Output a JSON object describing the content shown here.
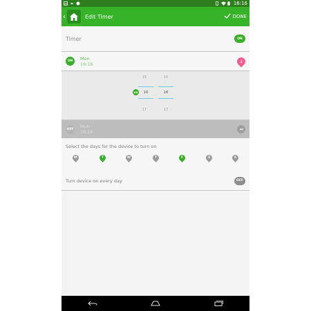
{
  "status_bar": {
    "time": "16:16"
  },
  "app_bar": {
    "back": "‹",
    "title": "Edit Timer",
    "done_label": "DONE"
  },
  "timer_row": {
    "label": "Timer",
    "toggle": "ON"
  },
  "on_event": {
    "badge": "ON",
    "day": "Mon",
    "time": "16:16"
  },
  "picker": {
    "hour_above": "15",
    "hour": "16",
    "hour_below": "17",
    "minute_above": "15",
    "minute": "16",
    "minute_below": "17",
    "badge": "ON"
  },
  "off_event": {
    "badge": "OFF",
    "day": "Mon",
    "time": "16:16"
  },
  "days_section": {
    "title": "Select the days for the device to turn on",
    "days": [
      {
        "label": "M",
        "selected": false
      },
      {
        "label": "T",
        "selected": true
      },
      {
        "label": "W",
        "selected": false
      },
      {
        "label": "T",
        "selected": false
      },
      {
        "label": "F",
        "selected": true
      },
      {
        "label": "S",
        "selected": false
      },
      {
        "label": "S",
        "selected": false
      }
    ]
  },
  "every_day_row": {
    "label": "Turn device on every day",
    "toggle": "OFF"
  },
  "colors": {
    "accent": "#37b329",
    "status": "#2e7d1e",
    "pink": "#f0608e"
  }
}
